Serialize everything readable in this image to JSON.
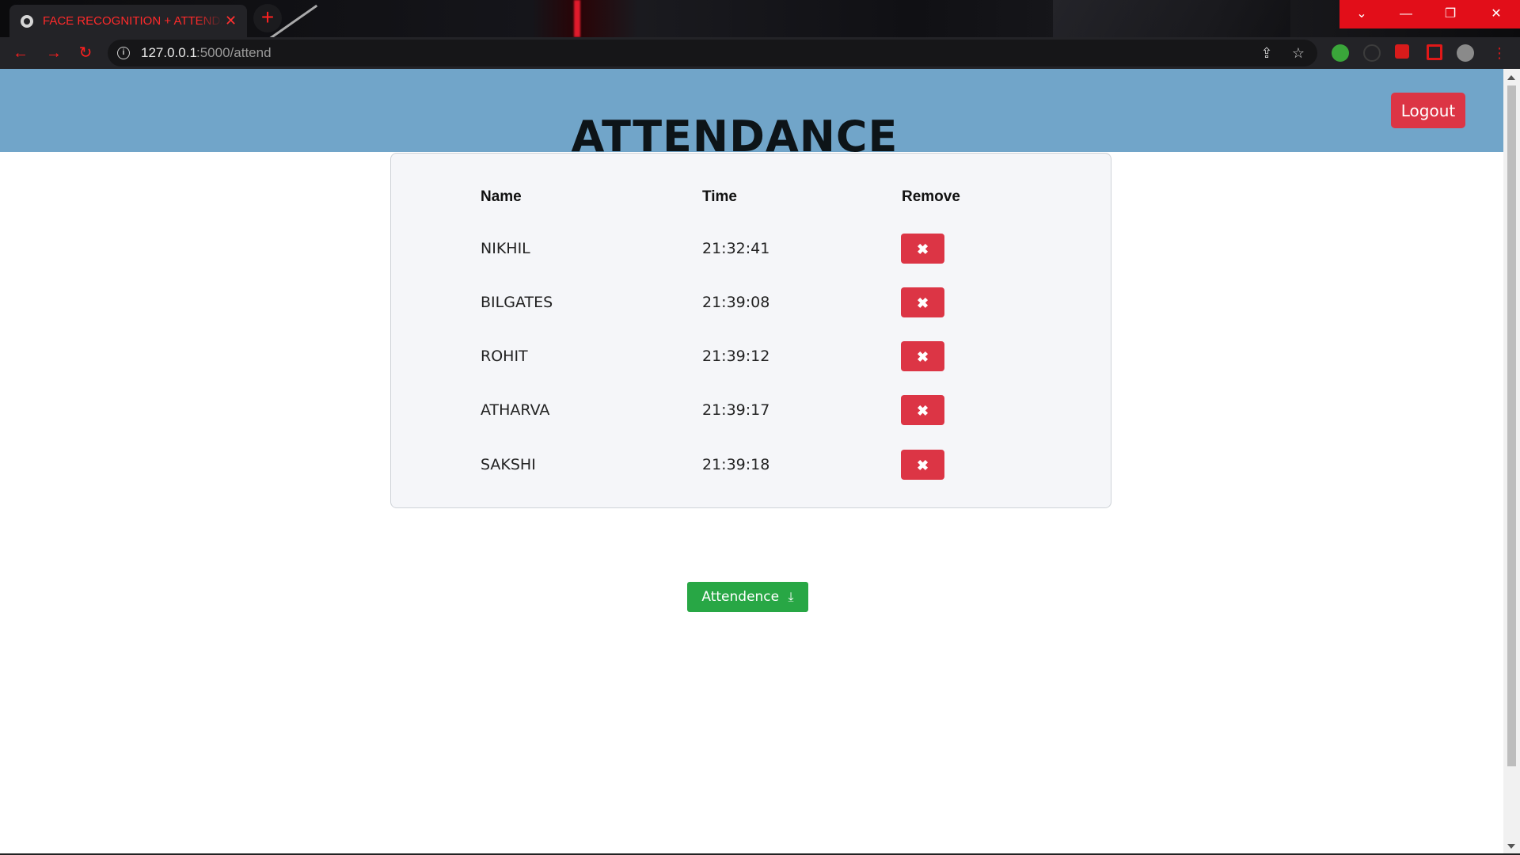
{
  "browser": {
    "tab_title": "FACE RECOGNITION + ATTENDANCE",
    "tab_close": "✕",
    "new_tab": "+",
    "url_host": "127.0.0.1",
    "url_path": ":5000/attend",
    "window_controls": {
      "dropdown": "⌄",
      "minimize": "—",
      "restore": "❐",
      "close": "✕"
    }
  },
  "header": {
    "title": "ATTENDANCE",
    "logout_label": "Logout",
    "background_color": "#71a5c9"
  },
  "table": {
    "columns": [
      "Name",
      "Time",
      "Remove"
    ],
    "rows": [
      {
        "name": "NIKHIL",
        "time": "21:32:41",
        "remove_glyph": "✖"
      },
      {
        "name": "BILGATES",
        "time": "21:39:08",
        "remove_glyph": "✖"
      },
      {
        "name": "ROHIT",
        "time": "21:39:12",
        "remove_glyph": "✖"
      },
      {
        "name": "ATHARVA",
        "time": "21:39:17",
        "remove_glyph": "✖"
      },
      {
        "name": "SAKSHI",
        "time": "21:39:18",
        "remove_glyph": "✖"
      }
    ]
  },
  "download": {
    "label": "Attendence",
    "icon": "download-icon",
    "color": "#28a745"
  },
  "colors": {
    "danger": "#dc3545",
    "success": "#28a745"
  }
}
